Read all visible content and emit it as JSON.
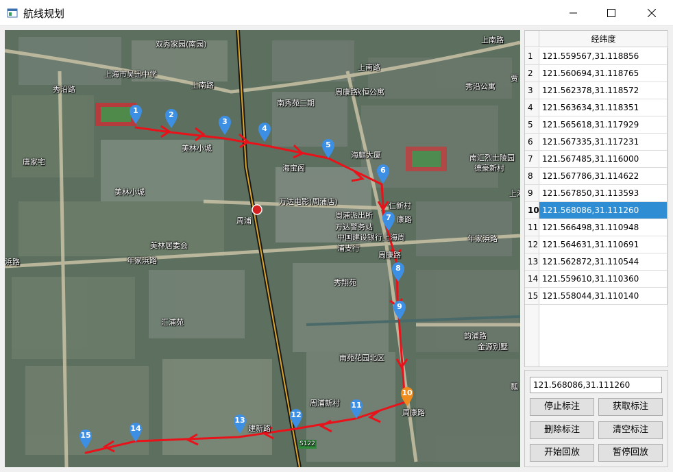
{
  "window": {
    "title": "航线规划",
    "icon": "app-window-icon",
    "controls": [
      "minimize-icon",
      "maximize-icon",
      "close-icon"
    ]
  },
  "map": {
    "labels": {
      "l1": "双秀家园(南园)",
      "l2": "上海市吴迅中学",
      "l3": "上南路",
      "l4": "上南路",
      "l5": "上南路",
      "l6": "秀沿路",
      "l7": "南秀苑二期",
      "l8": "永恒公寓",
      "l9": "秀沿公寓",
      "l10": "周康路",
      "l11": "美林小城",
      "l12": "唐家宅",
      "l13": "海宝阁",
      "l14": "海麒大厦",
      "l15": "南汇烈士陵园",
      "l16": "德豪新村",
      "l17": "美林小城",
      "l18": "万达电影(周浦店)",
      "l19": "周浦",
      "l20": "周浦派出所",
      "l21": "万达警务站",
      "l22": "中国建设银行上海周",
      "l23": "浦支行",
      "l24": "美林居委会",
      "l25": "年家浜路",
      "l26": "浜路",
      "l27": "年家浜路",
      "l28": "秀翔苑",
      "l29": "汇浦苑",
      "l30": "韵浦路",
      "l31": "金源别墅",
      "l32": "南苑花园北区",
      "l33": "周浦新村",
      "l34": "建新路",
      "l35": "S122",
      "l36": "周康路",
      "l37": "上海",
      "l38": "贾",
      "l39": "瓢",
      "l40": "仁新村",
      "l41": "周康路",
      "l42": "康路"
    },
    "markers": [
      "1",
      "2",
      "3",
      "4",
      "5",
      "6",
      "7",
      "8",
      "9",
      "10",
      "11",
      "12",
      "13",
      "14",
      "15"
    ],
    "marker_color": "#3d8fe4",
    "selected_marker_color": "#f08c1e",
    "route_color": "#e8131a"
  },
  "table": {
    "header": "经纬度",
    "rows": [
      {
        "num": "1",
        "value": "121.559567,31.118856"
      },
      {
        "num": "2",
        "value": "121.560694,31.118765"
      },
      {
        "num": "3",
        "value": "121.562378,31.118572"
      },
      {
        "num": "4",
        "value": "121.563634,31.118351"
      },
      {
        "num": "5",
        "value": "121.565618,31.117929"
      },
      {
        "num": "6",
        "value": "121.567335,31.117231"
      },
      {
        "num": "7",
        "value": "121.567485,31.116000"
      },
      {
        "num": "8",
        "value": "121.567786,31.114622"
      },
      {
        "num": "9",
        "value": "121.567850,31.113593"
      },
      {
        "num": "10",
        "value": "121.568086,31.111260"
      },
      {
        "num": "11",
        "value": "121.566498,31.110948"
      },
      {
        "num": "12",
        "value": "121.564631,31.110691"
      },
      {
        "num": "13",
        "value": "121.562872,31.110544"
      },
      {
        "num": "14",
        "value": "121.559610,31.110360"
      },
      {
        "num": "15",
        "value": "121.558044,31.110140"
      }
    ],
    "selected_row": "10",
    "selected_color": "#2f8ed3"
  },
  "controls": {
    "coord_value": "121.568086,31.111260",
    "stop_mark": "停止标注",
    "get_mark": "获取标注",
    "delete_mark": "删除标注",
    "clear_mark": "清空标注",
    "start_playback": "开始回放",
    "pause_playback": "暂停回放"
  }
}
